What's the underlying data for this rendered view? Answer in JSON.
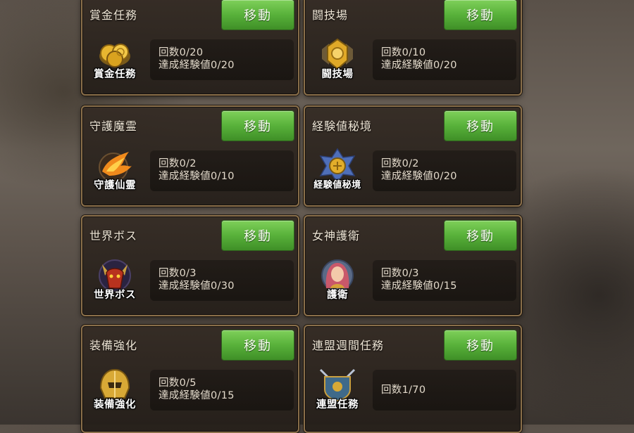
{
  "move_label": "移動",
  "cards": [
    {
      "title": "賞金任務",
      "icon": "gold-coins-icon",
      "caption": "賞金任務",
      "count": "回数0/20",
      "exp": "達成経験値0/20"
    },
    {
      "title": "闘技場",
      "icon": "arena-emblem-icon",
      "caption": "闘技場",
      "count": "回数0/10",
      "exp": "達成経験値0/20"
    },
    {
      "title": "守護魔霊",
      "icon": "guardian-phoenix-icon",
      "caption": "守護仙霊",
      "count": "回数0/2",
      "exp": "達成経験値0/10"
    },
    {
      "title": "経験値秘境",
      "icon": "exp-realm-crest-icon",
      "caption": "経験値秘境",
      "count": "回数0/2",
      "exp": "達成経験値0/20"
    },
    {
      "title": "世界ボス",
      "icon": "world-boss-icon",
      "caption": "世界ボス",
      "count": "回数0/3",
      "exp": "達成経験値0/30"
    },
    {
      "title": "女神護衛",
      "icon": "goddess-portrait-icon",
      "caption": "護衛",
      "count": "回数0/3",
      "exp": "達成経験値0/15"
    },
    {
      "title": "装備強化",
      "icon": "helmet-icon",
      "caption": "装備強化",
      "count": "回数0/5",
      "exp": "達成経験値0/15"
    },
    {
      "title": "連盟週間任務",
      "icon": "alliance-crest-icon",
      "caption": "連盟任務",
      "count": "回数1/70",
      "exp": ""
    }
  ]
}
